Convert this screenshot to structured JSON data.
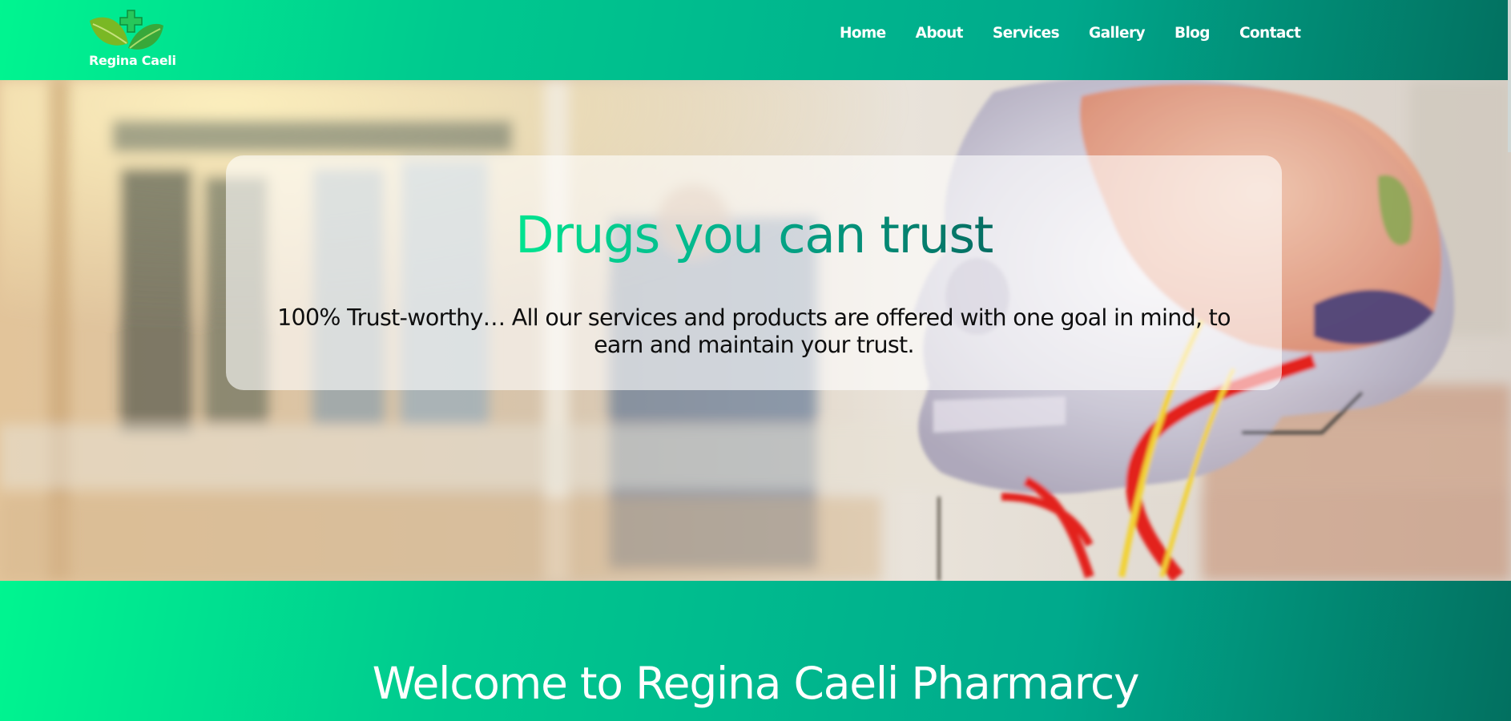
{
  "brand": {
    "name": "Regina Caeli",
    "logo_icon": "leaf-cross-icon"
  },
  "nav": {
    "items": [
      {
        "label": "Home"
      },
      {
        "label": "About"
      },
      {
        "label": "Services"
      },
      {
        "label": "Gallery"
      },
      {
        "label": "Blog"
      },
      {
        "label": "Contact"
      }
    ]
  },
  "hero": {
    "title": "Drugs you can trust",
    "subtitle": "100% Trust-worthy… All our services and products are offered with one goal in mind, to earn and maintain your trust.",
    "image": "anatomical-skull-model-photo"
  },
  "welcome": {
    "title": "Welcome to Regina Caeli Pharmarcy"
  },
  "colors": {
    "gradient_start": "#00f590",
    "gradient_mid": "#00a98c",
    "gradient_end": "#027060",
    "nav_text": "#ffffff",
    "hero_text": "#0e0e0e"
  }
}
